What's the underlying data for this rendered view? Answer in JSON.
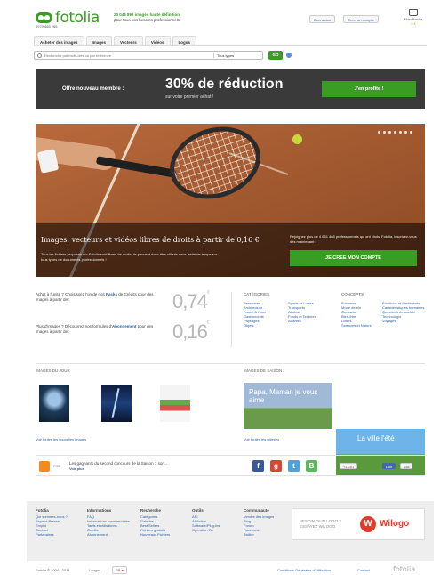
{
  "header": {
    "logo": "fotolia",
    "phone": "0970 465 265",
    "promo_line1": "20 046 892 images haute définition",
    "promo_line2": "pour tous vos besoins professionnels",
    "login": "Connexion",
    "signup": "Créer un compte",
    "cart_label": "Mon Panier",
    "cart_count": "0 €"
  },
  "nav": {
    "tabs": [
      "Acheter des images",
      "Images",
      "Vecteurs",
      "Vidéos",
      "Logos"
    ]
  },
  "search": {
    "placeholder": "Recherche par mots-clés ou par référence",
    "type_select": "Tous types",
    "go": "GO"
  },
  "banner": {
    "left": "Offre nouveau membre :",
    "big": "30% de réduction",
    "small": "sur votre premier achat !",
    "cta": "J'en profite !"
  },
  "hero": {
    "title": "Images, vecteurs et vidéos libres de droits à partir de 0,16 €",
    "text": "Tous les fichiers proposés sur Fotolia sont libres de droits, ils peuvent donc être utilisés sans limite de temps sur tous types de documents professionnels !",
    "join": "Rejoignez plus de 4 661 468 professionnels qui ont choisi Fotolia, inscrivez-vous dès maintenant !",
    "cta": "JE CRÉE MON COMPTE"
  },
  "pricing": {
    "packs_pre": "Achat à l'unité ? Choisissez l'un de nos ",
    "packs_link": "Packs",
    "packs_post": " de Crédits pour des images à partir de :",
    "packs_price": "0,74",
    "sub_pre": "Plus d'images ? Découvrez nos formules d'",
    "sub_link": "Abonnement",
    "sub_post": " pour des images à partir de :",
    "sub_price": "0,16",
    "currency": "€"
  },
  "categories": {
    "title": "CATÉGORIES",
    "col1": [
      "Personnes",
      "Architecture",
      "Faune & Flore",
      "Gastronomie",
      "Paysages",
      "Objets"
    ],
    "col2": [
      "Sports et Loisirs",
      "Transports",
      "Abstrait",
      "Fonds et Textures",
      "Activités"
    ]
  },
  "concepts": {
    "title": "CONCEPTS",
    "col1": [
      "Business",
      "Mode de Vie",
      "Contacts",
      "Bien-être",
      "Loisirs",
      "Sciences et Nature"
    ],
    "col2": [
      "Émotions et Sentiments",
      "Caractéristiques humaines",
      "Questions de société",
      "Technologie",
      "Voyages"
    ]
  },
  "daily": {
    "title": "IMAGES DU JOUR",
    "link": "Voir toutes les nouvelles images"
  },
  "season": {
    "title": "IMAGES DE SAISON",
    "img1": "Papa, Maman je vous aime",
    "img2": "La ville l'été",
    "link": "Voir toutes les galeries"
  },
  "social": {
    "rss": "RSS",
    "news": "Les gagnants du second concours de la Saison 3 son...",
    "more": "Voir plus",
    "gplus_count": "261",
    "like": "Like",
    "like_count": "15k"
  },
  "footer": {
    "cols": [
      {
        "title": "Fotolia",
        "items": [
          "Qui sommes-nous ?",
          "Espace Presse",
          "Emploi",
          "Contact",
          "Partenaires"
        ]
      },
      {
        "title": "Informations",
        "items": [
          "FAQ",
          "Informations commerciales",
          "Tarifs et utilisations",
          "Crédits",
          "Abonnement"
        ]
      },
      {
        "title": "Recherche",
        "items": [
          "Catégories",
          "Galeries",
          "Best Sellers",
          "Fichiers gratuits",
          "Nouveaux Fichiers"
        ]
      },
      {
        "title": "Outils",
        "items": [
          "API",
          "Affiliation",
          "Software/Plug-ins",
          "Opération Ter"
        ]
      },
      {
        "title": "Communauté",
        "items": [
          "Vendre des images",
          "Blog",
          "Forum",
          "Facebook",
          "Twitter"
        ]
      }
    ],
    "ad_line1": "BESOIN D'UN LOGO ?",
    "ad_line2": "ESSAYEZ WILOGO",
    "ad_brand": "Wilogo"
  },
  "bottom": {
    "copyright": "Fotolia © 2004 - 2014",
    "lang_label": "Langue",
    "lang_value": "FR",
    "terms": "Conditions Générales d'Utilisation",
    "contact": "Contact",
    "logo": "fotolia"
  }
}
